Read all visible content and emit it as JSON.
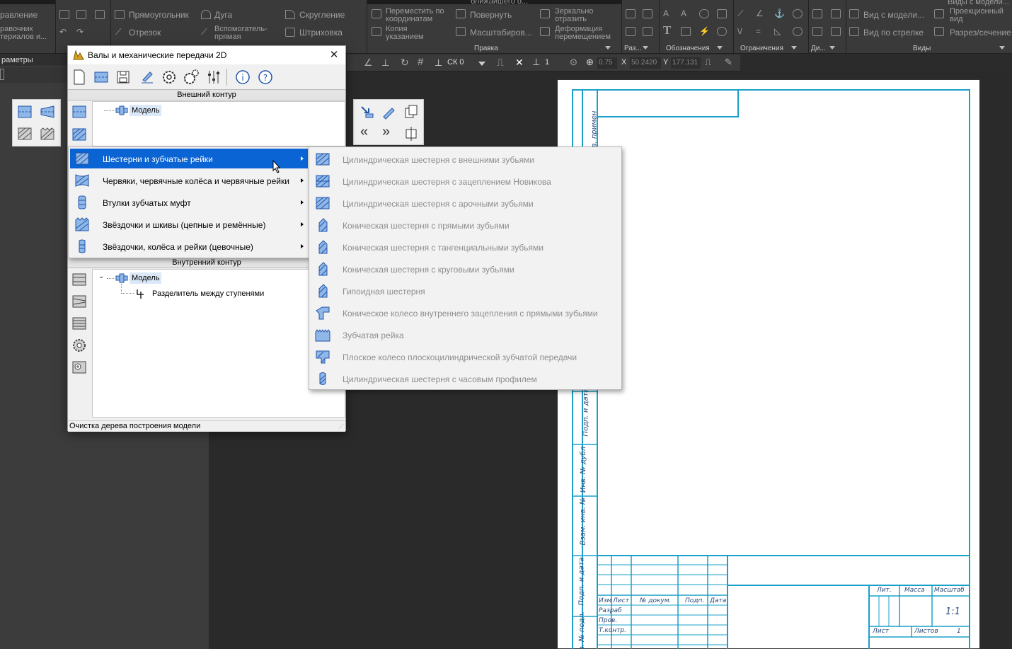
{
  "ribbon": {
    "col0": [
      "равление",
      "равочник",
      "териалов и..."
    ],
    "edit_items": [
      "Прямоугольник",
      "Дуга",
      "Скругление",
      "Отрезок",
      "Вспомогатель-",
      "прямая",
      "Штриховка"
    ],
    "pravka_items": [
      "Переместить по",
      "координатам",
      "Повернуть",
      "Зеркально",
      "отразить",
      "Копия",
      "указанием",
      "Масштабиров...",
      "Деформация",
      "перемещением"
    ],
    "top_cut": [
      "ближайшего о...",
      "Виды с модели..."
    ],
    "views_items": [
      "Вид с модели...",
      "Проекционный",
      "вид",
      "Вид по стрелке",
      "Разрез/сечение"
    ],
    "groups": [
      "Правка",
      "Раз...",
      "Обозначения",
      "Ограничения",
      "Ди...",
      "Виды"
    ]
  },
  "left_panel": {
    "title": "раметры"
  },
  "coord_bar": {
    "cs": "СК 0",
    "step": "1",
    "zoom": "0.75",
    "x_label": "X",
    "x_value": "50.2420",
    "y_label": "Y",
    "y_value": "177.131"
  },
  "dialog": {
    "title": "Валы и механические передачи 2D",
    "close": "✕",
    "outer_section": "Внешний контур",
    "inner_section": "Внутренний контур",
    "outer_tree": [
      {
        "label": "Модель"
      }
    ],
    "inner_tree": [
      {
        "label": "Модель"
      },
      {
        "label": "Разделитель между ступенями"
      }
    ],
    "status": "Очистка дерева построения модели"
  },
  "menu": {
    "items": [
      {
        "label": "Шестерни и зубчатые рейки",
        "highlighted": true
      },
      {
        "label": "Червяки, червячные колёса и червячные рейки"
      },
      {
        "label": "Втулки зубчатых муфт"
      },
      {
        "label": "Звёздочки и шкивы (цепные  и ремённые)"
      },
      {
        "label": "Звёздочки, колёса и рейки (цевочные)"
      }
    ]
  },
  "submenu": {
    "items": [
      {
        "label": "Цилиндрическая шестерня с внешними зубьями"
      },
      {
        "label": "Цилиндрическая шестерня с зацеплением Новикова"
      },
      {
        "label": "Цилиндрическая шестерня с арочными зубьями"
      },
      {
        "label": "Коническая шестерня с прямыми зубьями"
      },
      {
        "label": "Коническая шестерня с тангенциальными зубьями"
      },
      {
        "label": "Коническая шестерня с круговыми зубьями"
      },
      {
        "label": "Гипоидная шестерня"
      },
      {
        "label": "Коническое колесо внутреннего зацепления с прямыми зубьями"
      },
      {
        "label": "Зубчатая рейка"
      },
      {
        "label": "Плоское колесо плоскоцилиндрической зубчатой передачи"
      },
      {
        "label": "Цилиндрическая шестерня с часовым профилем"
      }
    ]
  },
  "title_block": {
    "side": [
      "Перв. примен",
      "Подп. и дата",
      "Инв. № дубл",
      "Взам. инв. №",
      "Подп. и дата",
      "Инв. № подл."
    ],
    "cols": [
      "Изм",
      "Лист",
      "№ докум.",
      "Подп.",
      "Дата"
    ],
    "rows": [
      "Разраб",
      "Пров.",
      "Т.контр."
    ],
    "lit": "Лит.",
    "mass": "Масса",
    "scale": "Масштаб",
    "scale_value": "1:1",
    "sheet": "Лист",
    "sheets": "Листов",
    "sheets_value": "1"
  },
  "colors": {
    "accent": "#0a64d4",
    "frame": "#1aa0c8",
    "icon_blue": "#3d7dd8"
  }
}
